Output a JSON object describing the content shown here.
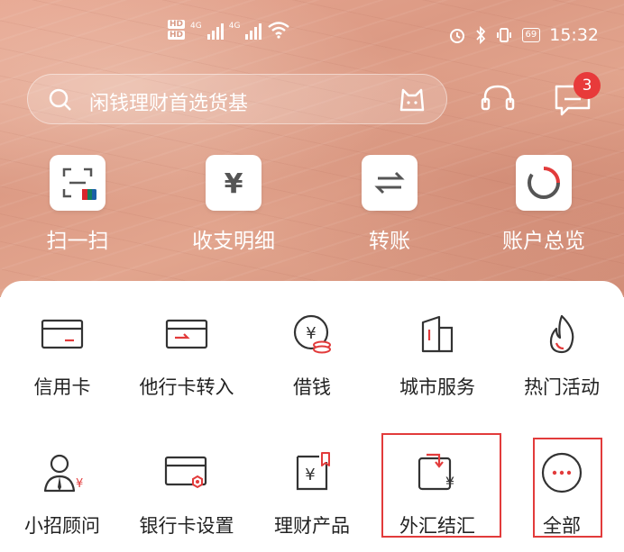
{
  "status_bar": {
    "hd_top": "HD",
    "hd_bottom": "HD",
    "net1": "4G",
    "net2": "4G",
    "battery": "69",
    "time": "15:32"
  },
  "search": {
    "placeholder": "闲钱理财首选货基"
  },
  "header": {
    "message_badge": "3"
  },
  "quick_actions": [
    {
      "label": "扫一扫",
      "icon": "scan-icon"
    },
    {
      "label": "收支明细",
      "icon": "yuan-icon"
    },
    {
      "label": "转账",
      "icon": "transfer-icon"
    },
    {
      "label": "账户总览",
      "icon": "account-overview-icon"
    }
  ],
  "grid": [
    {
      "label": "信用卡",
      "icon": "credit-card-icon"
    },
    {
      "label": "他行卡转入",
      "icon": "card-transfer-in-icon"
    },
    {
      "label": "借钱",
      "icon": "borrow-money-icon"
    },
    {
      "label": "城市服务",
      "icon": "city-service-icon"
    },
    {
      "label": "热门活动",
      "icon": "flame-icon"
    },
    {
      "label": "小招顾问",
      "icon": "advisor-icon"
    },
    {
      "label": "银行卡设置",
      "icon": "card-settings-icon"
    },
    {
      "label": "理财产品",
      "icon": "wealth-product-icon"
    },
    {
      "label": "外汇结汇",
      "icon": "forex-settlement-icon"
    },
    {
      "label": "全部",
      "icon": "more-icon"
    }
  ],
  "colors": {
    "accent": "#e23b3b",
    "icon_dark": "#333333"
  }
}
